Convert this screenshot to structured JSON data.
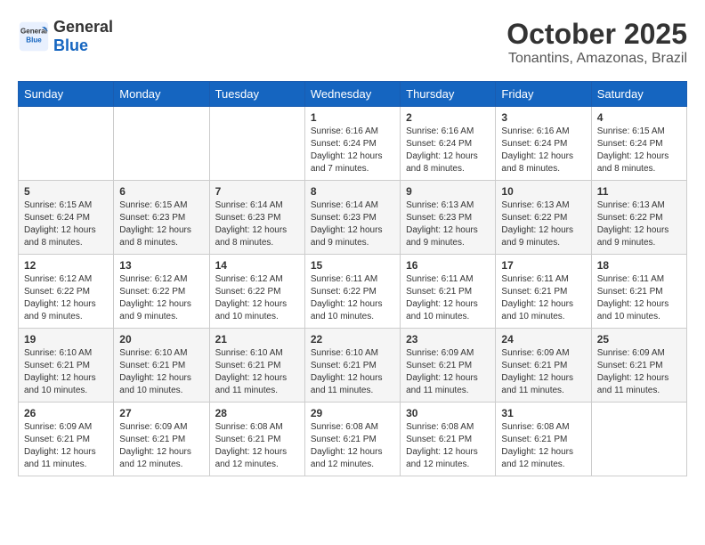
{
  "header": {
    "logo_general": "General",
    "logo_blue": "Blue",
    "month_title": "October 2025",
    "location": "Tonantins, Amazonas, Brazil"
  },
  "weekdays": [
    "Sunday",
    "Monday",
    "Tuesday",
    "Wednesday",
    "Thursday",
    "Friday",
    "Saturday"
  ],
  "weeks": [
    [
      {
        "day": "",
        "info": ""
      },
      {
        "day": "",
        "info": ""
      },
      {
        "day": "",
        "info": ""
      },
      {
        "day": "1",
        "info": "Sunrise: 6:16 AM\nSunset: 6:24 PM\nDaylight: 12 hours\nand 7 minutes."
      },
      {
        "day": "2",
        "info": "Sunrise: 6:16 AM\nSunset: 6:24 PM\nDaylight: 12 hours\nand 8 minutes."
      },
      {
        "day": "3",
        "info": "Sunrise: 6:16 AM\nSunset: 6:24 PM\nDaylight: 12 hours\nand 8 minutes."
      },
      {
        "day": "4",
        "info": "Sunrise: 6:15 AM\nSunset: 6:24 PM\nDaylight: 12 hours\nand 8 minutes."
      }
    ],
    [
      {
        "day": "5",
        "info": "Sunrise: 6:15 AM\nSunset: 6:24 PM\nDaylight: 12 hours\nand 8 minutes."
      },
      {
        "day": "6",
        "info": "Sunrise: 6:15 AM\nSunset: 6:23 PM\nDaylight: 12 hours\nand 8 minutes."
      },
      {
        "day": "7",
        "info": "Sunrise: 6:14 AM\nSunset: 6:23 PM\nDaylight: 12 hours\nand 8 minutes."
      },
      {
        "day": "8",
        "info": "Sunrise: 6:14 AM\nSunset: 6:23 PM\nDaylight: 12 hours\nand 9 minutes."
      },
      {
        "day": "9",
        "info": "Sunrise: 6:13 AM\nSunset: 6:23 PM\nDaylight: 12 hours\nand 9 minutes."
      },
      {
        "day": "10",
        "info": "Sunrise: 6:13 AM\nSunset: 6:22 PM\nDaylight: 12 hours\nand 9 minutes."
      },
      {
        "day": "11",
        "info": "Sunrise: 6:13 AM\nSunset: 6:22 PM\nDaylight: 12 hours\nand 9 minutes."
      }
    ],
    [
      {
        "day": "12",
        "info": "Sunrise: 6:12 AM\nSunset: 6:22 PM\nDaylight: 12 hours\nand 9 minutes."
      },
      {
        "day": "13",
        "info": "Sunrise: 6:12 AM\nSunset: 6:22 PM\nDaylight: 12 hours\nand 9 minutes."
      },
      {
        "day": "14",
        "info": "Sunrise: 6:12 AM\nSunset: 6:22 PM\nDaylight: 12 hours\nand 10 minutes."
      },
      {
        "day": "15",
        "info": "Sunrise: 6:11 AM\nSunset: 6:22 PM\nDaylight: 12 hours\nand 10 minutes."
      },
      {
        "day": "16",
        "info": "Sunrise: 6:11 AM\nSunset: 6:21 PM\nDaylight: 12 hours\nand 10 minutes."
      },
      {
        "day": "17",
        "info": "Sunrise: 6:11 AM\nSunset: 6:21 PM\nDaylight: 12 hours\nand 10 minutes."
      },
      {
        "day": "18",
        "info": "Sunrise: 6:11 AM\nSunset: 6:21 PM\nDaylight: 12 hours\nand 10 minutes."
      }
    ],
    [
      {
        "day": "19",
        "info": "Sunrise: 6:10 AM\nSunset: 6:21 PM\nDaylight: 12 hours\nand 10 minutes."
      },
      {
        "day": "20",
        "info": "Sunrise: 6:10 AM\nSunset: 6:21 PM\nDaylight: 12 hours\nand 10 minutes."
      },
      {
        "day": "21",
        "info": "Sunrise: 6:10 AM\nSunset: 6:21 PM\nDaylight: 12 hours\nand 11 minutes."
      },
      {
        "day": "22",
        "info": "Sunrise: 6:10 AM\nSunset: 6:21 PM\nDaylight: 12 hours\nand 11 minutes."
      },
      {
        "day": "23",
        "info": "Sunrise: 6:09 AM\nSunset: 6:21 PM\nDaylight: 12 hours\nand 11 minutes."
      },
      {
        "day": "24",
        "info": "Sunrise: 6:09 AM\nSunset: 6:21 PM\nDaylight: 12 hours\nand 11 minutes."
      },
      {
        "day": "25",
        "info": "Sunrise: 6:09 AM\nSunset: 6:21 PM\nDaylight: 12 hours\nand 11 minutes."
      }
    ],
    [
      {
        "day": "26",
        "info": "Sunrise: 6:09 AM\nSunset: 6:21 PM\nDaylight: 12 hours\nand 11 minutes."
      },
      {
        "day": "27",
        "info": "Sunrise: 6:09 AM\nSunset: 6:21 PM\nDaylight: 12 hours\nand 12 minutes."
      },
      {
        "day": "28",
        "info": "Sunrise: 6:08 AM\nSunset: 6:21 PM\nDaylight: 12 hours\nand 12 minutes."
      },
      {
        "day": "29",
        "info": "Sunrise: 6:08 AM\nSunset: 6:21 PM\nDaylight: 12 hours\nand 12 minutes."
      },
      {
        "day": "30",
        "info": "Sunrise: 6:08 AM\nSunset: 6:21 PM\nDaylight: 12 hours\nand 12 minutes."
      },
      {
        "day": "31",
        "info": "Sunrise: 6:08 AM\nSunset: 6:21 PM\nDaylight: 12 hours\nand 12 minutes."
      },
      {
        "day": "",
        "info": ""
      }
    ]
  ]
}
